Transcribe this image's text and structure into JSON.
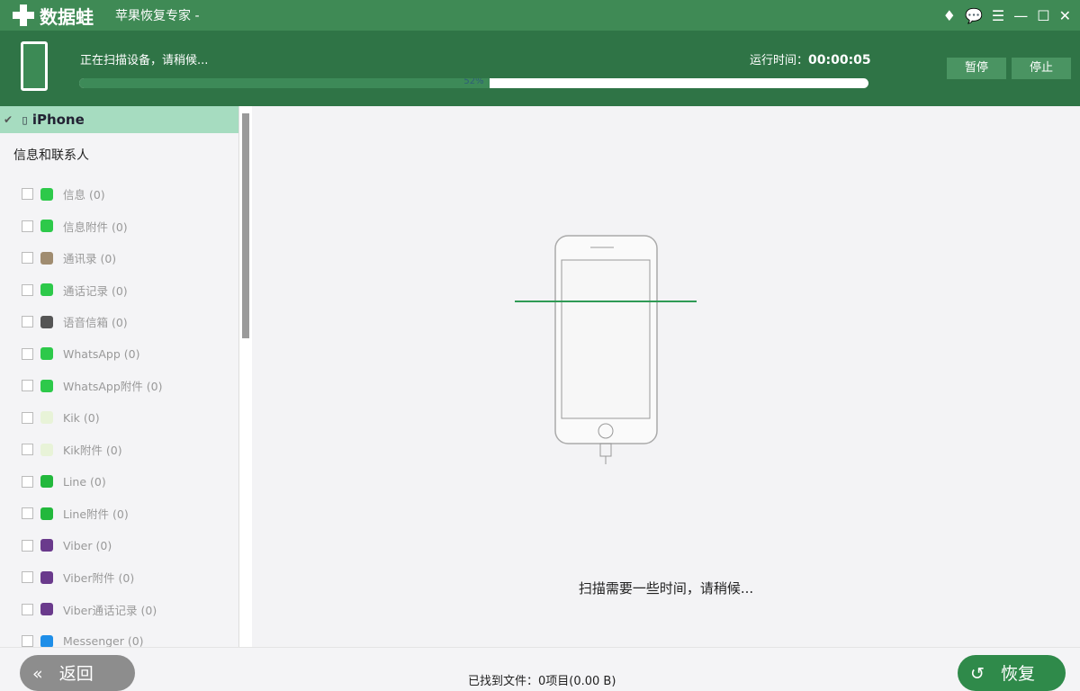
{
  "titlebar": {
    "brand": "数据蛙",
    "title": "苹果恢复专家 -",
    "icons": [
      "diamond-icon",
      "chat-icon",
      "feedback-icon",
      "minimize-icon",
      "maximize-icon",
      "close-icon"
    ]
  },
  "header": {
    "status": "正在扫描设备，请稍候...",
    "runtime_label": "运行时间：",
    "runtime": "00:00:05",
    "progress_label": "52%",
    "progress": 0.52,
    "pause": "暂停",
    "stop": "停止"
  },
  "sidebar": {
    "device": "iPhone",
    "group": "信息和联系人",
    "items": [
      {
        "label": "信息 (0)",
        "color": "#2dc94a"
      },
      {
        "label": "信息附件 (0)",
        "color": "#2dc94a"
      },
      {
        "label": "通讯录 (0)",
        "color": "#a08c70"
      },
      {
        "label": "通话记录 (0)",
        "color": "#2dc94a"
      },
      {
        "label": "语音信箱 (0)",
        "color": "#555555"
      },
      {
        "label": "WhatsApp (0)",
        "color": "#2dc94a"
      },
      {
        "label": "WhatsApp附件 (0)",
        "color": "#2dc94a"
      },
      {
        "label": "Kik (0)",
        "color": "#e8f3d8"
      },
      {
        "label": "Kik附件 (0)",
        "color": "#e8f3d8"
      },
      {
        "label": "Line (0)",
        "color": "#22b83c"
      },
      {
        "label": "Line附件 (0)",
        "color": "#22b83c"
      },
      {
        "label": "Viber (0)",
        "color": "#6a3a8c"
      },
      {
        "label": "Viber附件 (0)",
        "color": "#6a3a8c"
      },
      {
        "label": "Viber通话记录 (0)",
        "color": "#6a3a8c"
      },
      {
        "label": "Messenger (0)",
        "color": "#1e8ee8"
      }
    ]
  },
  "main": {
    "message": "扫描需要一些时间，请稍候..."
  },
  "footer": {
    "back": "返回",
    "found": "已找到文件：0项目(0.00 B)",
    "recover": "恢复"
  }
}
